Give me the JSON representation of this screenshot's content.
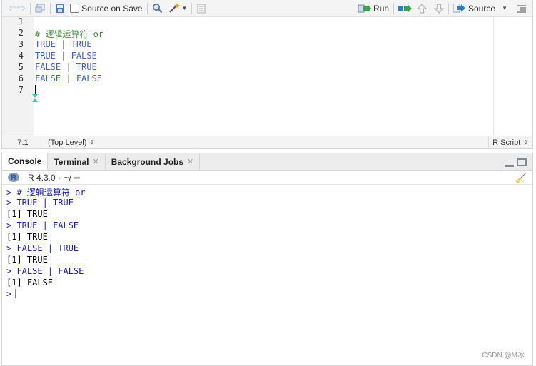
{
  "editor": {
    "toolbar": {
      "source_on_save_label": "Source on Save",
      "run_label": "Run",
      "source_label": "Source"
    },
    "line_numbers": [
      "1",
      "2",
      "3",
      "4",
      "5",
      "6",
      "7"
    ],
    "code": {
      "line2": "# 逻辑运算符 or",
      "line3_left": "TRUE",
      "line3_op": "|",
      "line3_right": "TRUE",
      "line4_left": "TRUE",
      "line4_op": "|",
      "line4_right": "FALSE",
      "line5_left": "FALSE",
      "line5_op": "|",
      "line5_right": "TRUE",
      "line6_left": "FALSE",
      "line6_op": "|",
      "line6_right": "FALSE"
    },
    "status": {
      "position": "7:1",
      "scope": "(Top Level)",
      "file_type": "R Script"
    }
  },
  "console": {
    "tabs": [
      {
        "label": "Console"
      },
      {
        "label": "Terminal"
      },
      {
        "label": "Background Jobs"
      }
    ],
    "r_version": "R 4.3.0",
    "working_dir": "~/",
    "lines": [
      "> # 逻辑运算符 or",
      "> TRUE | TRUE",
      "[1] TRUE",
      "> TRUE | FALSE",
      "[1] TRUE",
      "> FALSE | TRUE",
      "[1] TRUE",
      "> FALSE | FALSE",
      "[1] FALSE",
      ">"
    ]
  },
  "watermark": "CSDN @M冰",
  "colors": {
    "keyword": "#4060c8",
    "comment": "#3c8a3c",
    "console_input": "#1a1ab8"
  }
}
